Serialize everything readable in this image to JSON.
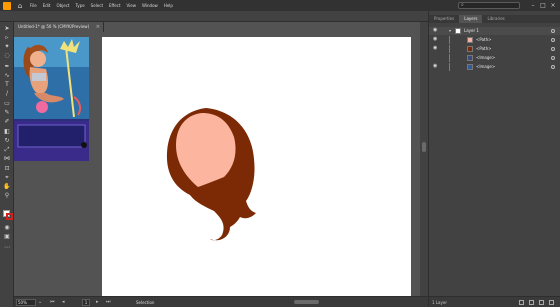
{
  "menubar": {
    "items": [
      "File",
      "Edit",
      "Object",
      "Type",
      "Select",
      "Effect",
      "View",
      "Window",
      "Help"
    ],
    "search_placeholder": "Search Adobe Help"
  },
  "document": {
    "tab_title": "Untitled-1* @ 50 % (CMYK/Preview)"
  },
  "statusbar": {
    "zoom": "50%",
    "artboard_number": "1",
    "status_mode": "Selection"
  },
  "panel": {
    "tabs": [
      "Properties",
      "Layers",
      "Libraries"
    ],
    "active_tab": "Layers",
    "layers": [
      {
        "name": "Layer 1",
        "level": 0,
        "visible": true,
        "color": "#4f7cff"
      },
      {
        "name": "<Path>",
        "level": 1,
        "visible": true,
        "thumb": "#f4b3a0"
      },
      {
        "name": "<Path>",
        "level": 1,
        "visible": true,
        "thumb": "#7a2a0a"
      },
      {
        "name": "<Image>",
        "level": 1,
        "visible": false,
        "thumb": "#3a4a7a"
      },
      {
        "name": "<Image>",
        "level": 1,
        "visible": true,
        "thumb": "#355a9a"
      }
    ],
    "footer_text": "1 Layer"
  },
  "colors": {
    "hair": "#7c2a06",
    "face": "#fcb59f",
    "brand": "#ff9a00"
  }
}
